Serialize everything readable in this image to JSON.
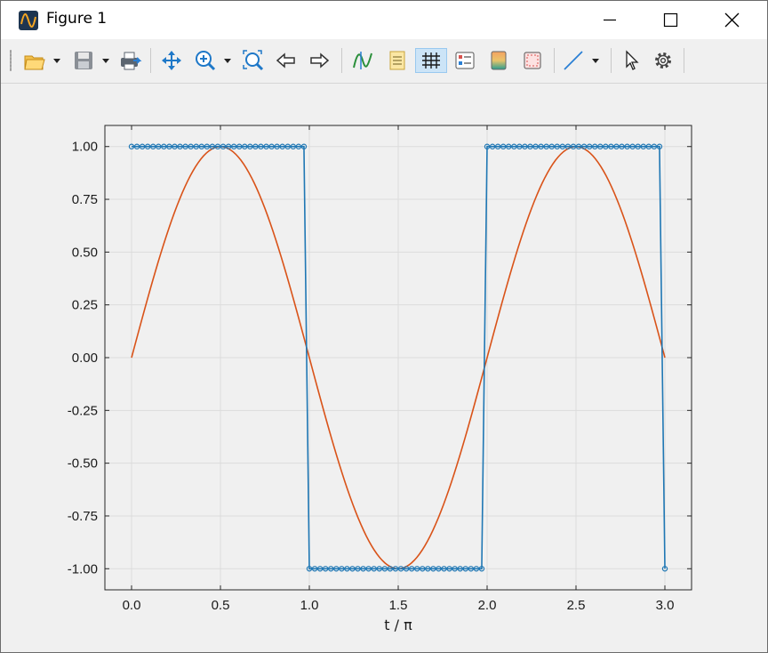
{
  "window": {
    "title": "Figure 1"
  },
  "toolbar": {
    "icons": [
      "open-file-icon",
      "dropdown-icon",
      "save-icon",
      "dropdown-icon",
      "print-export-icon",
      "pan-icon",
      "zoom-in-icon",
      "dropdown-icon",
      "zoom-fit-icon",
      "back-arrow-icon",
      "forward-arrow-icon",
      "data-cursor-icon",
      "legend-icon",
      "grid-icon",
      "property-editor-icon",
      "colorbar-icon",
      "box-icon",
      "line-tool-icon",
      "dropdown-icon",
      "select-pointer-icon",
      "settings-gear-icon"
    ]
  },
  "colors": {
    "series_square": "#1f77b4",
    "series_sine": "#d95319",
    "axes_bg": "#f0f0f0",
    "grid": "#dcdcdc"
  },
  "chart_data": {
    "type": "line",
    "title": "",
    "xlabel": "t / π",
    "ylabel": "",
    "xlim": [
      -0.15,
      3.15
    ],
    "ylim": [
      -1.1,
      1.1
    ],
    "xticks": [
      0.0,
      0.5,
      1.0,
      1.5,
      2.0,
      2.5,
      3.0
    ],
    "xtick_labels": [
      "0.0",
      "0.5",
      "1.0",
      "1.5",
      "2.0",
      "2.5",
      "3.0"
    ],
    "yticks": [
      1.0,
      0.75,
      0.5,
      0.25,
      0.0,
      -0.25,
      -0.5,
      -0.75,
      -1.0
    ],
    "ytick_labels": [
      "1.00",
      "0.75",
      "0.50",
      "0.25",
      "0.00",
      "-0.25",
      "-0.50",
      "-0.75",
      "-1.00"
    ],
    "grid": true,
    "series": [
      {
        "type": "step-markers",
        "x": [
          0.0,
          0.0303,
          0.0606,
          0.0909,
          0.1212,
          0.1515,
          0.1818,
          0.2121,
          0.2424,
          0.2727,
          0.303,
          0.3333,
          0.3636,
          0.3939,
          0.4242,
          0.4545,
          0.4848,
          0.5152,
          0.5455,
          0.5758,
          0.6061,
          0.6364,
          0.6667,
          0.697,
          0.7273,
          0.7576,
          0.7879,
          0.8182,
          0.8485,
          0.8788,
          0.9091,
          0.9394,
          0.9697,
          1.0,
          1.0303,
          1.0606,
          1.0909,
          1.1212,
          1.1515,
          1.1818,
          1.2121,
          1.2424,
          1.2727,
          1.303,
          1.3333,
          1.3636,
          1.3939,
          1.4242,
          1.4545,
          1.4848,
          1.5152,
          1.5455,
          1.5758,
          1.6061,
          1.6364,
          1.6667,
          1.697,
          1.7273,
          1.7576,
          1.7879,
          1.8182,
          1.8485,
          1.8788,
          1.9091,
          1.9394,
          1.9697,
          2.0,
          2.0303,
          2.0606,
          2.0909,
          2.1212,
          2.1515,
          2.1818,
          2.2121,
          2.2424,
          2.2727,
          2.303,
          2.3333,
          2.3636,
          2.3939,
          2.4242,
          2.4545,
          2.4848,
          2.5152,
          2.5455,
          2.5758,
          2.6061,
          2.6364,
          2.6667,
          2.697,
          2.7273,
          2.7576,
          2.7879,
          2.8182,
          2.8485,
          2.8788,
          2.9091,
          2.9394,
          2.9697,
          3.0
        ],
        "y": [
          1,
          1,
          1,
          1,
          1,
          1,
          1,
          1,
          1,
          1,
          1,
          1,
          1,
          1,
          1,
          1,
          1,
          1,
          1,
          1,
          1,
          1,
          1,
          1,
          1,
          1,
          1,
          1,
          1,
          1,
          1,
          1,
          1,
          -1,
          -1,
          -1,
          -1,
          -1,
          -1,
          -1,
          -1,
          -1,
          -1,
          -1,
          -1,
          -1,
          -1,
          -1,
          -1,
          -1,
          -1,
          -1,
          -1,
          -1,
          -1,
          -1,
          -1,
          -1,
          -1,
          -1,
          -1,
          -1,
          -1,
          -1,
          -1,
          -1,
          1,
          1,
          1,
          1,
          1,
          1,
          1,
          1,
          1,
          1,
          1,
          1,
          1,
          1,
          1,
          1,
          1,
          1,
          1,
          1,
          1,
          1,
          1,
          1,
          1,
          1,
          1,
          1,
          1,
          1,
          1,
          1,
          1,
          -1
        ]
      },
      {
        "type": "line",
        "function": "sin(πt)",
        "x_range": [
          0,
          3
        ],
        "samples": 200
      }
    ]
  }
}
